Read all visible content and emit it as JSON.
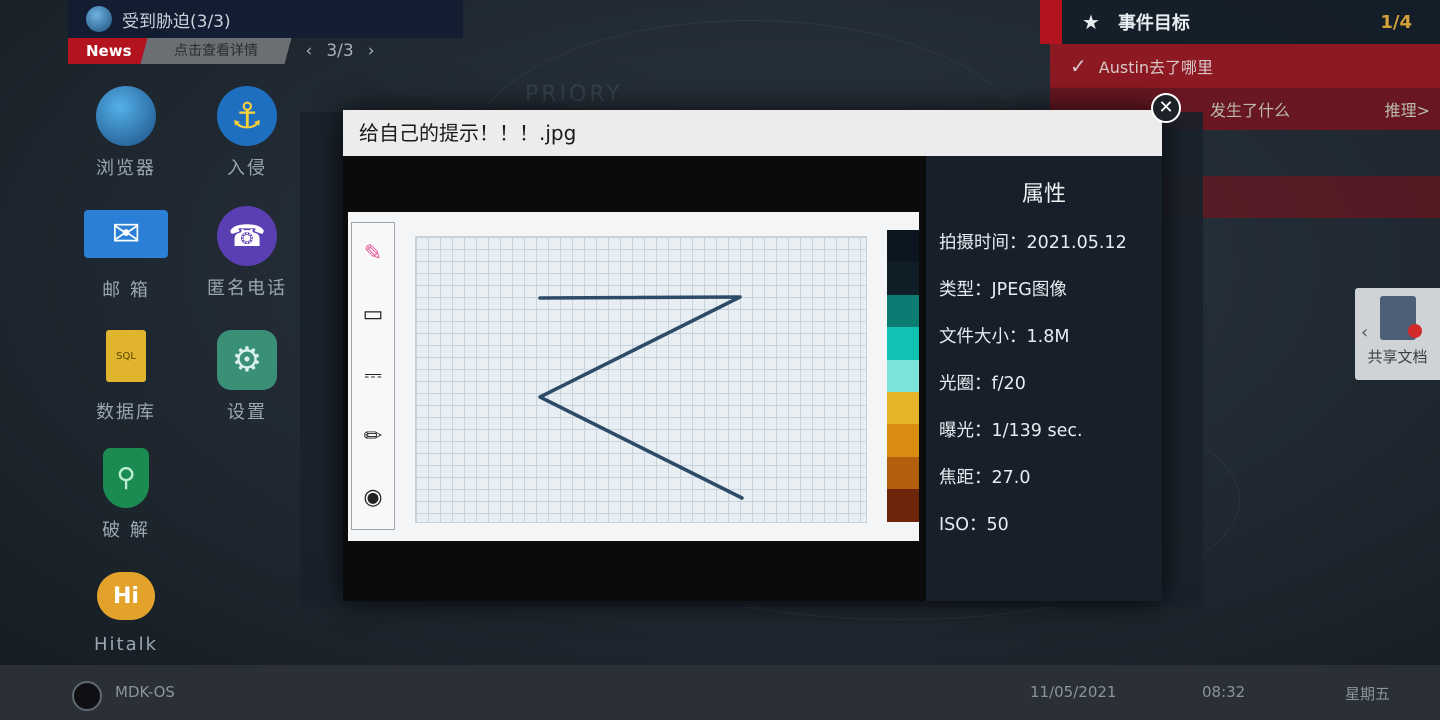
{
  "news": {
    "title": "受到胁迫(3/3)",
    "tag": "News",
    "link": "点击查看详情",
    "page": "3/3",
    "prev_icon": "chevron-left-icon",
    "next_icon": "chevron-right-icon"
  },
  "desktop_apps": [
    {
      "label": "浏览器",
      "icon": "globe-icon"
    },
    {
      "label": "入侵",
      "icon": "hook-icon"
    },
    {
      "label": "邮 箱",
      "icon": "mail-icon"
    },
    {
      "label": "匿名电话",
      "icon": "phone-icon"
    },
    {
      "label": "数据库",
      "icon": "sql-file-icon"
    },
    {
      "label": "设置",
      "icon": "gear-icon"
    },
    {
      "label": "破 解",
      "icon": "key-shield-icon"
    },
    {
      "label": "Hitalk",
      "icon": "hitalk-icon"
    }
  ],
  "events": {
    "title": "事件目标",
    "count": "1/4",
    "item1": "Austin去了哪里",
    "item2": "发生了什么",
    "item2_action": "推理>"
  },
  "share": {
    "label": "共享文档"
  },
  "dialog": {
    "title": "给自己的提示！！！.jpg",
    "props_title": "属性",
    "props": [
      "拍摄时间：2021.05.12",
      "类型：JPEG图像",
      "文件大小：1.8M",
      "光圈：f/20",
      "曝光：1/139 sec.",
      "焦距：27.0",
      "ISO：50"
    ],
    "palette_colors": [
      "#0b1621",
      "#0f1e27",
      "#0b7c72",
      "#10c2b4",
      "#7ee3da",
      "#e8b52a",
      "#d98d10",
      "#b45f0c",
      "#6e260a"
    ],
    "tools": [
      "highlighter-icon",
      "eraser-icon",
      "stamp-icon",
      "brush-icon",
      "beard-icon"
    ]
  },
  "taskbar": {
    "os": "MDK-OS",
    "date": "11/05/2021",
    "time": "08:32",
    "day": "星期五"
  }
}
